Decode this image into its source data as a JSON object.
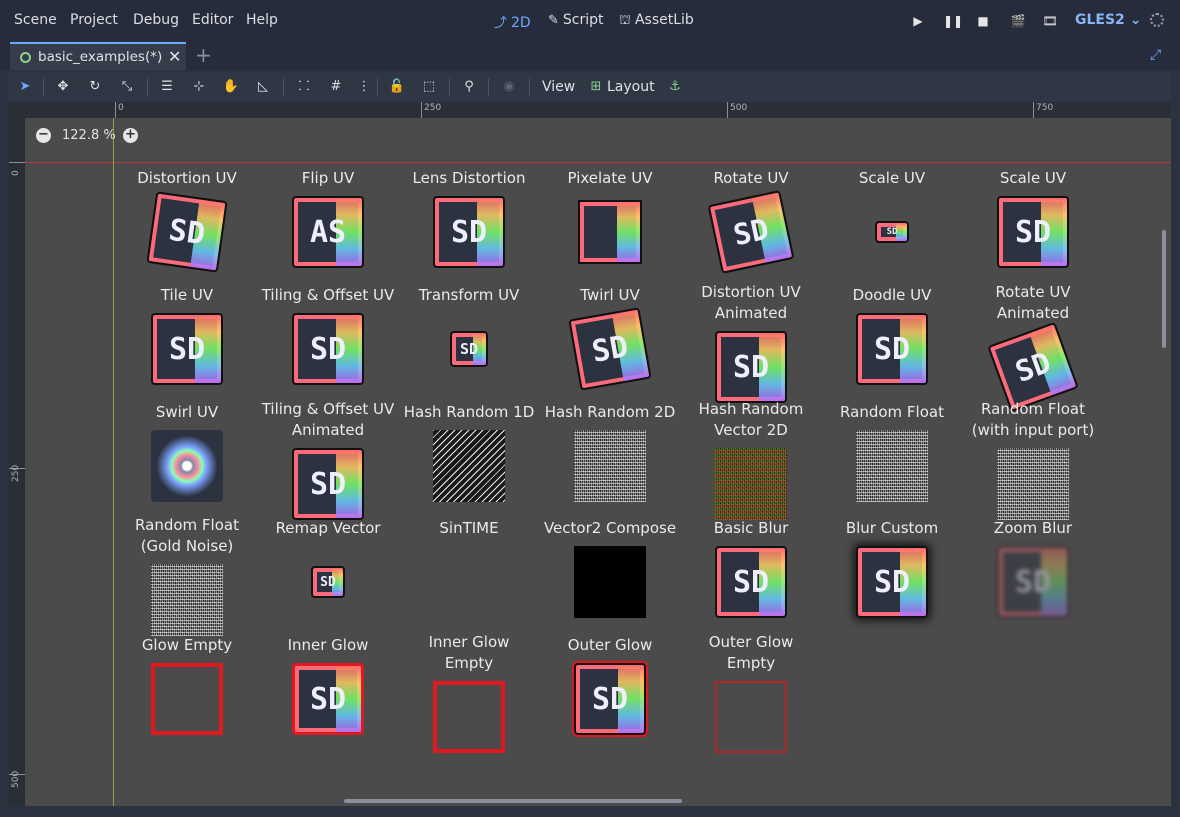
{
  "menu": [
    "Scene",
    "Project",
    "Debug",
    "Editor",
    "Help"
  ],
  "modes": [
    {
      "label": "2D",
      "icon": "2d-icon",
      "active": true
    },
    {
      "label": "Script",
      "icon": "script-icon",
      "active": false
    },
    {
      "label": "AssetLib",
      "icon": "assetlib-icon",
      "active": false
    }
  ],
  "renderer": "GLES2",
  "tab": {
    "label": "basic_examples(*)"
  },
  "toolbar": {
    "view_label": "View",
    "layout_label": "Layout"
  },
  "zoom": "122.8 %",
  "ruler": {
    "h_ticks": [
      "0",
      "250",
      "500",
      "750"
    ],
    "v_ticks": [
      "0",
      "250",
      "500"
    ]
  },
  "items": [
    {
      "title": "Distortion UV",
      "kind": "sd"
    },
    {
      "title": "Flip UV",
      "kind": "sd",
      "text": "AS"
    },
    {
      "title": "Lens Distortion",
      "kind": "sd"
    },
    {
      "title": "Pixelate UV",
      "kind": "pixel"
    },
    {
      "title": "Rotate UV",
      "kind": "sd"
    },
    {
      "title": "Scale UV",
      "kind": "sd"
    },
    {
      "title": "Scale UV",
      "kind": "sd"
    },
    {
      "title": "Tile UV",
      "kind": "sd"
    },
    {
      "title": "Tiling & Offset UV",
      "kind": "sd"
    },
    {
      "title": "Transform UV",
      "kind": "sd"
    },
    {
      "title": "Twirl UV",
      "kind": "sd"
    },
    {
      "title": "Distortion UV\nAnimated",
      "kind": "sd"
    },
    {
      "title": "Doodle UV",
      "kind": "sd"
    },
    {
      "title": "Rotate UV\nAnimated",
      "kind": "sd"
    },
    {
      "title": "Swirl UV",
      "kind": "swirl"
    },
    {
      "title": "Tiling & Offset UV\nAnimated",
      "kind": "sd"
    },
    {
      "title": "Hash Random 1D",
      "kind": "hash"
    },
    {
      "title": "Hash Random 2D",
      "kind": "noise"
    },
    {
      "title": "Hash Random\nVector 2D",
      "kind": "noisecolor"
    },
    {
      "title": "Random Float",
      "kind": "noise"
    },
    {
      "title": "Random Float\n(with input port)",
      "kind": "noise"
    },
    {
      "title": "Random Float\n(Gold Noise)",
      "kind": "noise"
    },
    {
      "title": "Remap Vector",
      "kind": "sd"
    },
    {
      "title": "SinTIME",
      "kind": "empty"
    },
    {
      "title": "Vector2 Compose",
      "kind": "black"
    },
    {
      "title": "Basic Blur",
      "kind": "sd"
    },
    {
      "title": "Blur Custom",
      "kind": "sd"
    },
    {
      "title": "Zoom Blur",
      "kind": "sd"
    },
    {
      "title": "Glow Empty",
      "kind": "red"
    },
    {
      "title": "Inner Glow",
      "kind": "sd"
    },
    {
      "title": "Inner Glow\nEmpty",
      "kind": "red"
    },
    {
      "title": "Outer Glow",
      "kind": "sd"
    },
    {
      "title": "Outer Glow\nEmpty",
      "kind": "redthin"
    }
  ],
  "sd_text": "SD"
}
